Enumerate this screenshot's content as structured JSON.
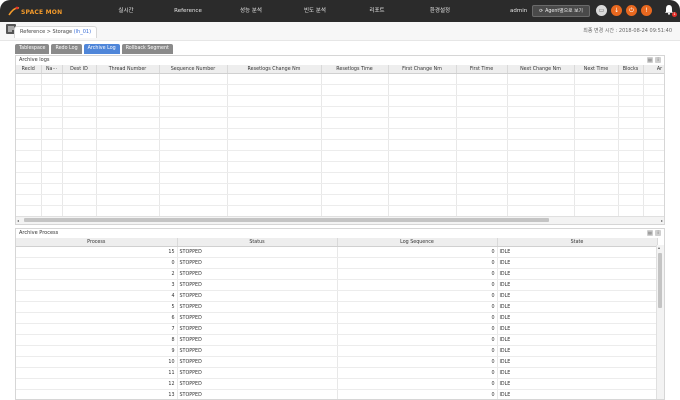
{
  "app": {
    "logo_text": "SPACE MON",
    "nav": [
      "실시간",
      "Reference",
      "성능 분석",
      "빈도 분석",
      "리포트",
      "환경설정"
    ],
    "user": "admin",
    "agent_button": "Agent별으로 보기",
    "notification_badge": "1",
    "colors": {
      "topbar": "#2b2b2b",
      "accent_orange": "#e8681f",
      "active_tab": "#4f86d9"
    }
  },
  "header": {
    "breadcrumb_prefix": "Reference > Storage ",
    "breadcrumb_highlight": "(lh_01)",
    "last_change": "최종 변경 시간 : 2018-08-24 09:51:40"
  },
  "tabs": [
    {
      "label": "Tablespace",
      "active": false
    },
    {
      "label": "Redo Log",
      "active": false
    },
    {
      "label": "Archive Log",
      "active": true
    },
    {
      "label": "Rollback Segment",
      "active": false
    }
  ],
  "archive_logs": {
    "title": "Archive logs",
    "columns": [
      "RecId",
      "Na···",
      "Dest ID",
      "Thread Number",
      "Sequence Number",
      "Resetlogs Change Nm",
      "Resetlogs Time",
      "First Change Nm",
      "First Time",
      "Next Change Nm",
      "Next Time",
      "Blocks",
      "Ar"
    ],
    "empty_rows": 14
  },
  "archive_process": {
    "title": "Archive Process",
    "columns": [
      "Process",
      "Status",
      "Log Sequence",
      "State"
    ],
    "rows": [
      [
        "15",
        "STOPPED",
        "0",
        "IDLE"
      ],
      [
        "0",
        "STOPPED",
        "0",
        "IDLE"
      ],
      [
        "2",
        "STOPPED",
        "0",
        "IDLE"
      ],
      [
        "3",
        "STOPPED",
        "0",
        "IDLE"
      ],
      [
        "4",
        "STOPPED",
        "0",
        "IDLE"
      ],
      [
        "5",
        "STOPPED",
        "0",
        "IDLE"
      ],
      [
        "6",
        "STOPPED",
        "0",
        "IDLE"
      ],
      [
        "7",
        "STOPPED",
        "0",
        "IDLE"
      ],
      [
        "8",
        "STOPPED",
        "0",
        "IDLE"
      ],
      [
        "9",
        "STOPPED",
        "0",
        "IDLE"
      ],
      [
        "10",
        "STOPPED",
        "0",
        "IDLE"
      ],
      [
        "11",
        "STOPPED",
        "0",
        "IDLE"
      ],
      [
        "12",
        "STOPPED",
        "0",
        "IDLE"
      ],
      [
        "13",
        "STOPPED",
        "0",
        "IDLE"
      ]
    ]
  }
}
